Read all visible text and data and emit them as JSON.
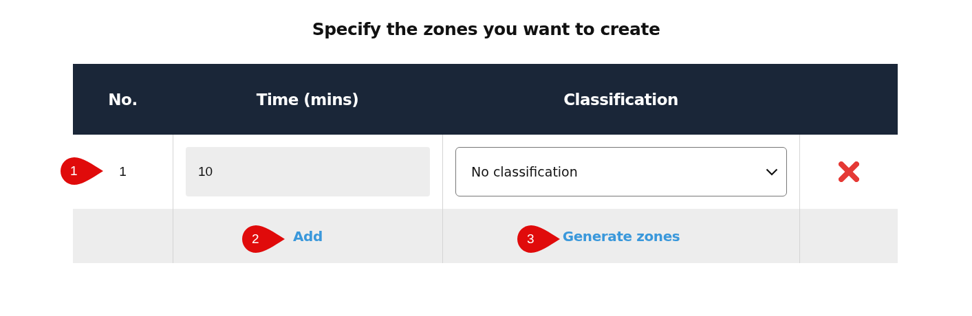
{
  "title": "Specify the zones you want to create",
  "table": {
    "columns": [
      "No.",
      "Time (mins)",
      "Classification"
    ],
    "rows": [
      {
        "number": "1",
        "time": "10",
        "classification": "No classification",
        "callout": "1"
      }
    ],
    "footer": {
      "add": {
        "label": "Add",
        "callout": "2"
      },
      "generate": {
        "label": "Generate zones",
        "callout": "3"
      }
    }
  }
}
